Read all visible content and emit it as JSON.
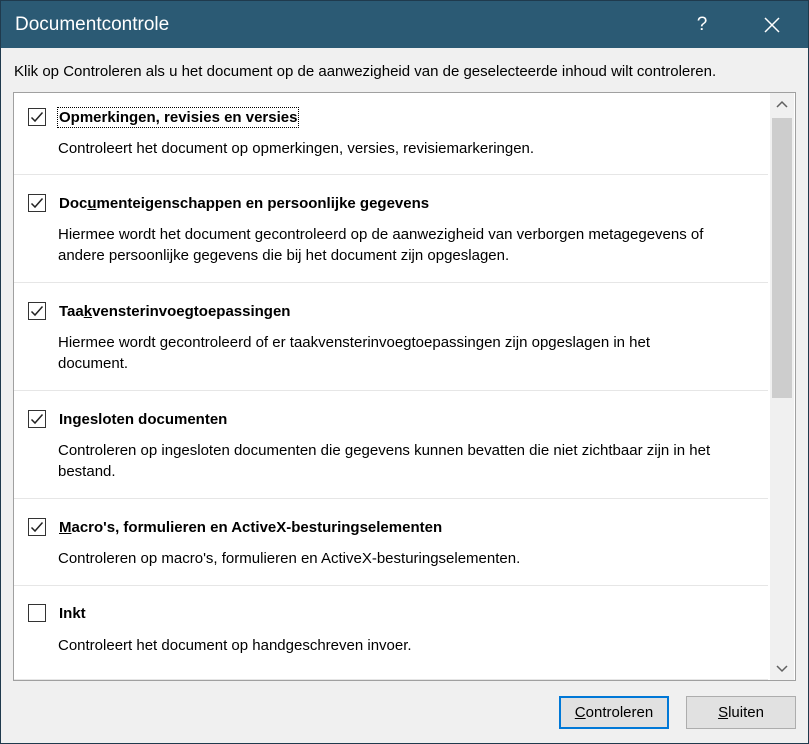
{
  "window": {
    "title": "Documentcontrole",
    "help_label": "?",
    "titlebar_color": "#2b5a74"
  },
  "instruction": "Klik op Controleren als u het document op de aanwezigheid van de geselecteerde inhoud wilt controleren.",
  "items": [
    {
      "title": "Opmerkingen, revisies en versies",
      "checked": true,
      "focused": true,
      "description": "Controleert het document op opmerkingen, versies, revisiemarkeringen."
    },
    {
      "title_pre": "Doc",
      "title_ul": "u",
      "title_post": "menteigenschappen en persoonlijke gegevens",
      "checked": true,
      "description_line1": "Hiermee wordt het document gecontroleerd op de aanwezigheid van verborgen metagegevens of",
      "description_line2": "andere persoonlijke gegevens die bij het document zijn opgeslagen."
    },
    {
      "title_pre": "Taa",
      "title_ul": "k",
      "title_post": "vensterinvoegtoepassingen",
      "checked": true,
      "description_line1": "Hiermee wordt gecontroleerd of er taakvensterinvoegtoepassingen zijn opgeslagen in het",
      "description_line2": "document."
    },
    {
      "title": "Ingesloten documenten",
      "checked": true,
      "description_line1": "Controleren op ingesloten documenten die gegevens kunnen bevatten die niet zichtbaar zijn in het",
      "description_line2": "bestand."
    },
    {
      "title_pre": "",
      "title_ul": "M",
      "title_post": "acro's, formulieren en ActiveX-besturingselementen",
      "checked": true,
      "description": "Controleren op macro's, formulieren en ActiveX-besturingselementen."
    },
    {
      "title": "Inkt",
      "checked": false,
      "description": "Controleert het document op handgeschreven invoer."
    }
  ],
  "buttons": {
    "check_ul": "C",
    "check_rest": "ontroleren",
    "close_ul": "S",
    "close_rest": "luiten"
  },
  "icons": {
    "close": "close-icon",
    "checkmark": "checkmark-icon",
    "scroll_up": "chevron-up-icon",
    "scroll_down": "chevron-down-icon"
  }
}
